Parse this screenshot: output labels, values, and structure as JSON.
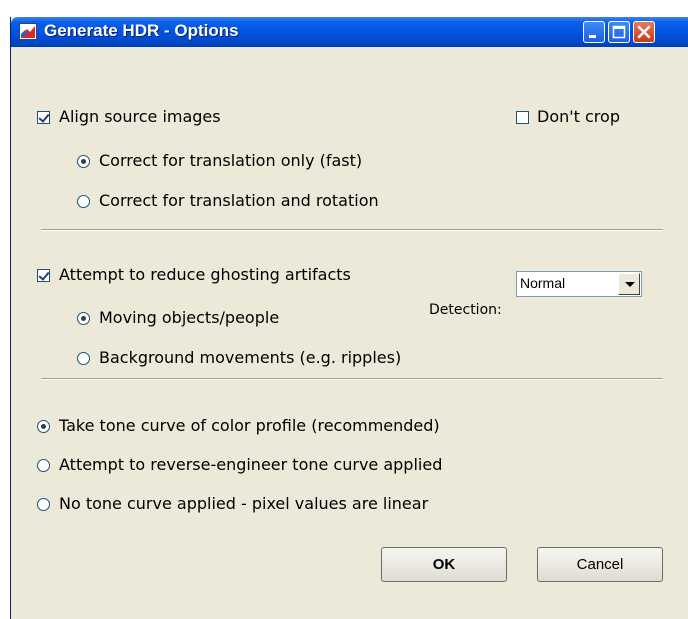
{
  "window": {
    "title": "Generate HDR - Options"
  },
  "titlebar_buttons": {
    "minimize_icon": "minimize-icon",
    "maximize_icon": "maximize-icon",
    "close_icon": "close-icon"
  },
  "align": {
    "label": "Align source images",
    "checked": true,
    "dont_crop_label": "Don't crop",
    "dont_crop_checked": false,
    "options": [
      {
        "label": "Correct for translation only (fast)",
        "selected": true
      },
      {
        "label": "Correct for translation and rotation",
        "selected": false
      }
    ]
  },
  "ghosting": {
    "label": "Attempt to reduce ghosting artifacts",
    "checked": true,
    "options": [
      {
        "label": "Moving objects/people",
        "selected": true
      },
      {
        "label": "Background movements (e.g. ripples)",
        "selected": false
      }
    ],
    "detection_label": "Detection:",
    "detection_value": "Normal"
  },
  "tone_curve": {
    "options": [
      {
        "label": "Take tone curve of color profile (recommended)",
        "selected": true
      },
      {
        "label": "Attempt to reverse-engineer tone curve applied",
        "selected": false
      },
      {
        "label": "No tone curve applied - pixel values are linear",
        "selected": false
      }
    ]
  },
  "buttons": {
    "ok": "OK",
    "cancel": "Cancel"
  }
}
